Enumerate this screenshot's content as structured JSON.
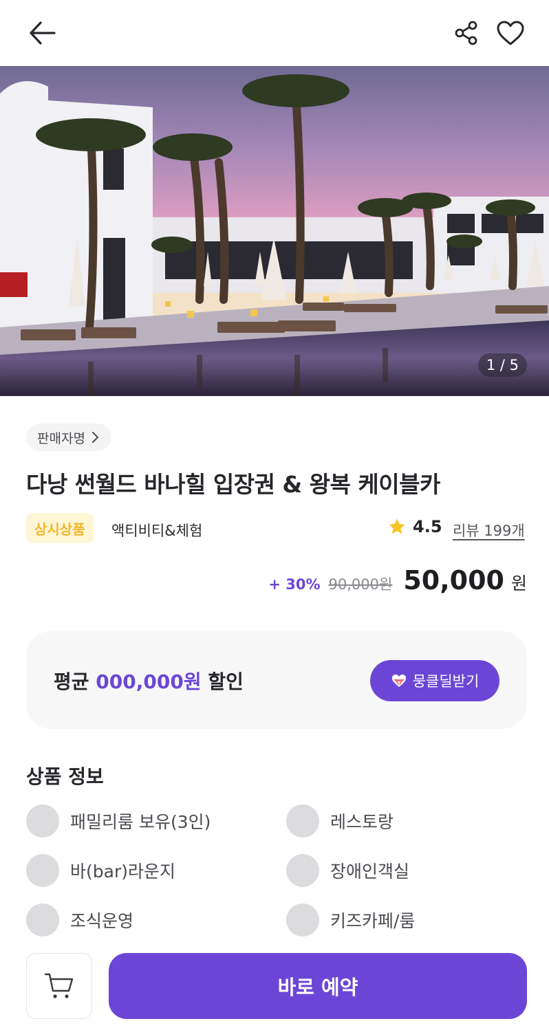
{
  "header": {
    "back_icon": "arrow-left-icon",
    "share_icon": "share-icon",
    "favorite_icon": "heart-icon"
  },
  "gallery": {
    "image_description": "resort pool at dusk with palm trees",
    "counter": "1 / 5"
  },
  "product": {
    "seller_label": "판매자명",
    "title": "다낭 썬월드 바나힐 입장권 & 왕복 케이블카",
    "badge": "상시상품",
    "category": "액티비티&체험",
    "rating": "4.5",
    "review_link": "리뷰 199개",
    "discount": "+ 30%",
    "original_price": "90,000원",
    "final_price": "50,000",
    "currency": "원"
  },
  "promo": {
    "prefix": "평균",
    "amount": "000,000원",
    "suffix": "할인",
    "button_label": "뭉클딜받기"
  },
  "info": {
    "section_title": "상품 정보",
    "amenities": [
      "패밀리룸 보유(3인)",
      "레스토랑",
      "바(bar)라운지",
      "장애인객실",
      "조식운영",
      "키즈카페/룸"
    ]
  },
  "bottom_bar": {
    "cart_icon": "cart-icon",
    "book_label": "바로 예약"
  },
  "colors": {
    "accent": "#6b46d6",
    "badge_bg": "#fff6d6",
    "badge_text": "#f2b62a",
    "star": "#f7c325"
  }
}
